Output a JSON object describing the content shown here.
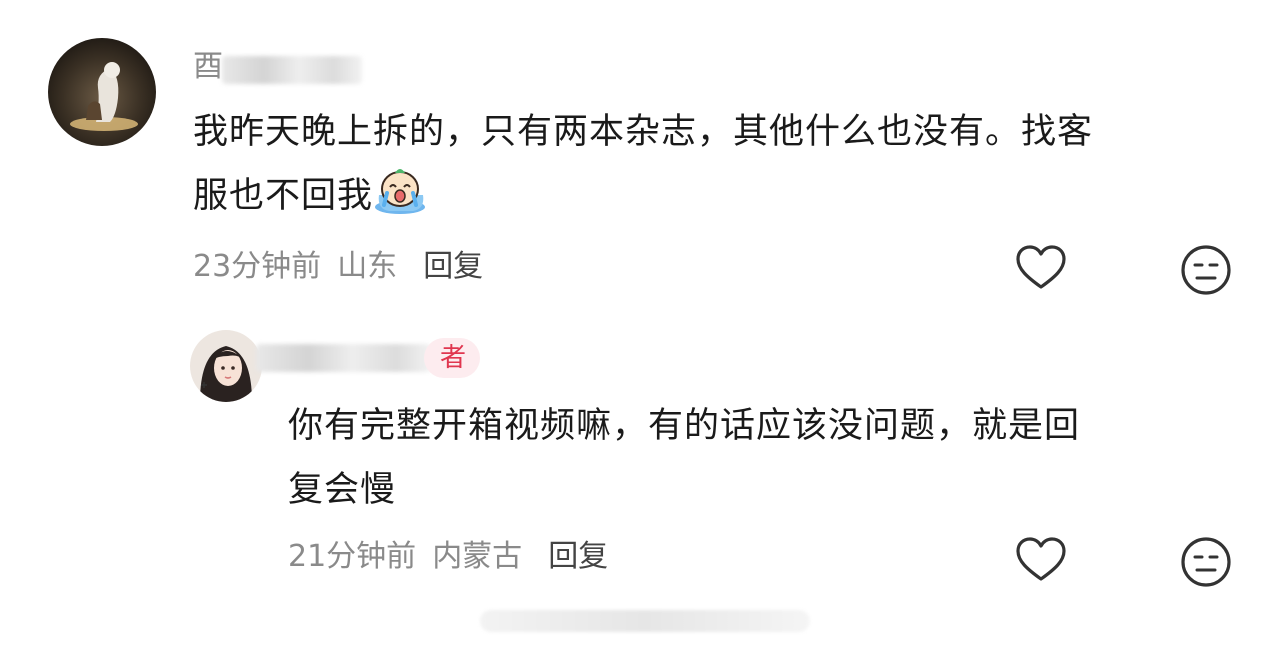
{
  "comments": [
    {
      "username_visible": "酉",
      "text": "我昨天晚上拆的，只有两本杂志，其他什么也没有。找客服也不回我",
      "text_line1": "我昨天晚上拆的，只有两本杂志，其他什么也没有。找客",
      "text_line2": "服也不回我",
      "time": "23分钟前",
      "location": "山东",
      "reply_label": "回复",
      "emoji": "crying-face-emoji"
    },
    {
      "badge": "者",
      "text": "你有完整开箱视频嘛，有的话应该没问题，就是回复会慢",
      "text_line1": "你有完整开箱视频嘛，有的话应该没问题，就是回",
      "text_line2": "复会慢",
      "time": "21分钟前",
      "location": "内蒙古",
      "reply_label": "回复"
    }
  ],
  "colors": {
    "meta": "#8a8a8a",
    "badge_bg": "#fdecef",
    "badge_text": "#e0364f",
    "icon_stroke": "#333333"
  },
  "icons": [
    "heart-icon",
    "dislike-face-icon"
  ]
}
